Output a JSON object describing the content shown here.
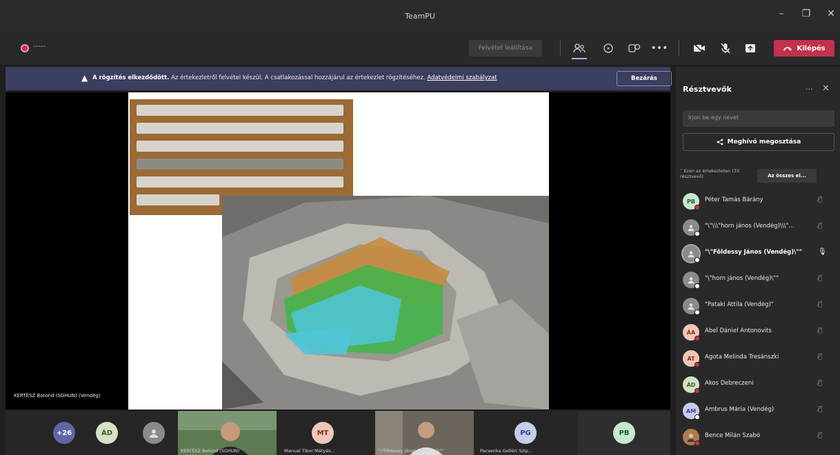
{
  "window": {
    "title": "TeamPU"
  },
  "toolbar": {
    "timer": "-----",
    "stop_recording_label": "Felvétel leállítása",
    "leave_label": "Kilépés",
    "icons": [
      "people-icon",
      "chat-icon",
      "reactions-icon",
      "more-icon",
      "camera-off-icon",
      "mic-off-icon",
      "share-tray-icon"
    ]
  },
  "banner": {
    "bold": "A rögzítés elkezdődött.",
    "text": " Az értekezletről felvétel készül. A csatlakozással hozzájárul az értekezlet rögzítéséhez. ",
    "link": "Adatvédelmi szabályzat",
    "close_label": "Bezárás"
  },
  "stage": {
    "presenter_caption": "KERTÉSZ Botond (SGHUN) (Vendég)"
  },
  "strip": {
    "tiles": [
      {
        "initials": "+26",
        "color": "#6264a7",
        "text": "#fff"
      },
      {
        "initials": "ÁD",
        "color": "#d3e2c4",
        "text": "#3b5a26"
      },
      {
        "initials": "",
        "color": "#8a8a8a",
        "text": "#fff"
      },
      {
        "caption": "KERTÉSZ Botond (SGHUN)"
      },
      {
        "initials": "MT",
        "color": "#f1c6b7",
        "text": "#7a3419",
        "caption": "Manual Tibor Mátyás..."
      },
      {
        "caption": "\"\\\"Földessy János (Vendég)\\\"\""
      },
      {
        "initials": "PG",
        "color": "#c6cdea",
        "text": "#354189",
        "caption": "Pecsenka Gellért Szip..."
      },
      {
        "initials": "PB",
        "color": "#c7e7cf",
        "text": "#215a32"
      }
    ]
  },
  "panel": {
    "title": "Résztvevők",
    "invite_placeholder": "Írjon be egy nevet",
    "share_invite_label": "Meghívó megosztása",
    "section_label": "Ezen az értekezleten (33 résztvevő)",
    "admit_all_label": "Az összes el...",
    "participants": [
      {
        "initials": "PB",
        "color": "#c7e7cf",
        "text": "#215a32",
        "name": "Péter Tamás Bárány",
        "status": "#c4314b"
      },
      {
        "initials": "",
        "color": "#8a8a8a",
        "text": "#fff",
        "name": "\"\\\"\\\\\\\"horn jános (Vendég)\\\\\\\"...",
        "status": "#fff"
      },
      {
        "initials": "",
        "color": "#8a8a8a",
        "text": "#fff",
        "name": "\"\\\"Földessy János (Vendég)\\\"\"",
        "status": "#fff",
        "speaking": true
      },
      {
        "initials": "",
        "color": "#8a8a8a",
        "text": "#fff",
        "name": "\"\\\"horn jános (Vendég)\\\"\"",
        "status": "#fff"
      },
      {
        "initials": "",
        "color": "#8a8a8a",
        "text": "#fff",
        "name": "\"Pataki Attila (Vendég)\"",
        "status": "#fff"
      },
      {
        "initials": "ÁA",
        "color": "#f1c6b7",
        "text": "#7a3419",
        "name": "Ábel Dániel Antonovits",
        "status": "#c4314b"
      },
      {
        "initials": "ÁT",
        "color": "#f1c6b7",
        "text": "#7a3419",
        "name": "Ágota Melinda Tresánszki",
        "status": "#c4314b"
      },
      {
        "initials": "ÁD",
        "color": "#d3e2c4",
        "text": "#3b5a26",
        "name": "Ákos Debreczeni",
        "status": "#c4314b"
      },
      {
        "initials": "AM",
        "color": "#c6cdea",
        "text": "#354189",
        "name": "Ambrus Mária (Vendég)",
        "status": "#fff"
      },
      {
        "initials": "",
        "color": "#b07a4f",
        "text": "#fff",
        "name": "Bence Milán Szabó",
        "status": "#c4314b"
      }
    ]
  }
}
